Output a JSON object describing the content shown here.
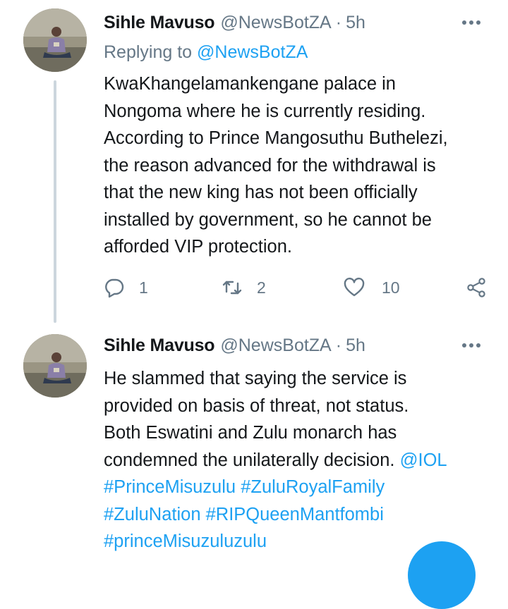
{
  "tweets": [
    {
      "author_name": "Sihle Mavuso",
      "handle": "@NewsBotZA",
      "separator": "·",
      "time": "5h",
      "replying_to_prefix": "Replying to",
      "replying_to_handle": "@NewsBotZA",
      "lines": [
        "KwaKhangelamankengane palace in",
        "Nongoma where he is currently residing.",
        "According to Prince Mangosuthu Buthelezi,",
        "the reason advanced for the withdrawal is",
        "that the new king has not been officially",
        "installed by government, so he cannot be",
        "afforded VIP protection."
      ],
      "reply_count": "1",
      "retweet_count": "2",
      "like_count": "10",
      "icons": {
        "reply": "reply-icon",
        "retweet": "retweet-icon",
        "like": "heart-icon",
        "share": "share-icon",
        "more": "more-options-icon"
      }
    },
    {
      "author_name": "Sihle Mavuso",
      "handle": "@NewsBotZA",
      "separator": "·",
      "time": "5h",
      "lines": [
        "He slammed that saying the service is",
        "provided on basis of threat, not status.",
        "Both Eswatini and Zulu monarch has",
        "condemned the unilaterally decision."
      ],
      "line4_mention": "@IOL",
      "hashtags": [
        "#PrinceMisuzulu",
        "#ZuluRoyalFamily",
        "#ZuluNation",
        "#RIPQueenMantfombi",
        "#princeMisuzuluzulu"
      ]
    }
  ],
  "colors": {
    "accent": "#1da1f2",
    "text": "#14171a",
    "muted": "#657786",
    "thread_line": "#ccd6dd"
  }
}
